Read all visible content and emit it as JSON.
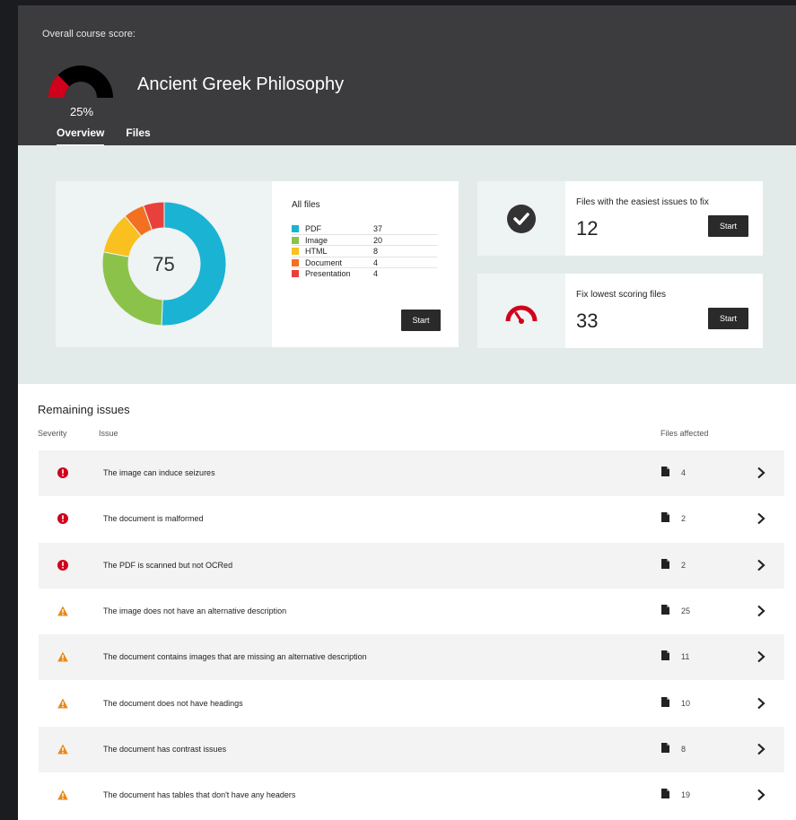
{
  "header": {
    "score_label": "Overall course score:",
    "score_pct": "25%",
    "score_value": 0.25,
    "course_title": "Ancient Greek Philosophy",
    "tabs": [
      {
        "label": "Overview",
        "active": true
      },
      {
        "label": "Files",
        "active": false
      }
    ]
  },
  "colors": {
    "pdf": "#1ab3d3",
    "image": "#8bc34a",
    "html": "#f9c01f",
    "document": "#f37021",
    "presentation": "#e8413b",
    "gauge_fill": "#d0021b",
    "warning": "#e88a1a"
  },
  "all_files": {
    "title": "All files",
    "total": "75",
    "start_label": "Start",
    "legend": [
      {
        "name": "PDF",
        "count": "37",
        "color": "#1ab3d3"
      },
      {
        "name": "Image",
        "count": "20",
        "color": "#8bc34a"
      },
      {
        "name": "HTML",
        "count": "8",
        "color": "#f9c01f"
      },
      {
        "name": "Document",
        "count": "4",
        "color": "#f37021"
      },
      {
        "name": "Presentation",
        "count": "4",
        "color": "#e8413b"
      }
    ]
  },
  "actions": [
    {
      "title": "Files with the easiest issues to fix",
      "count": "12",
      "start_label": "Start",
      "icon": "check-circle-icon"
    },
    {
      "title": "Fix lowest scoring files",
      "count": "33",
      "start_label": "Start",
      "icon": "speedometer-icon"
    }
  ],
  "issues": {
    "title": "Remaining issues",
    "columns": {
      "severity": "Severity",
      "issue": "Issue",
      "files": "Files affected"
    },
    "rows": [
      {
        "severity": "severe",
        "text": "The image can induce seizures",
        "files": "4"
      },
      {
        "severity": "severe",
        "text": "The document is malformed",
        "files": "2"
      },
      {
        "severity": "severe",
        "text": "The PDF is scanned but not OCRed",
        "files": "2"
      },
      {
        "severity": "warning",
        "text": "The image does not have an alternative description",
        "files": "25"
      },
      {
        "severity": "warning",
        "text": "The document contains images that are missing an alternative description",
        "files": "11"
      },
      {
        "severity": "warning",
        "text": "The document does not have headings",
        "files": "10"
      },
      {
        "severity": "warning",
        "text": "The document has contrast issues",
        "files": "8"
      },
      {
        "severity": "warning",
        "text": "The document has tables that don't have any headers",
        "files": "19"
      }
    ]
  }
}
